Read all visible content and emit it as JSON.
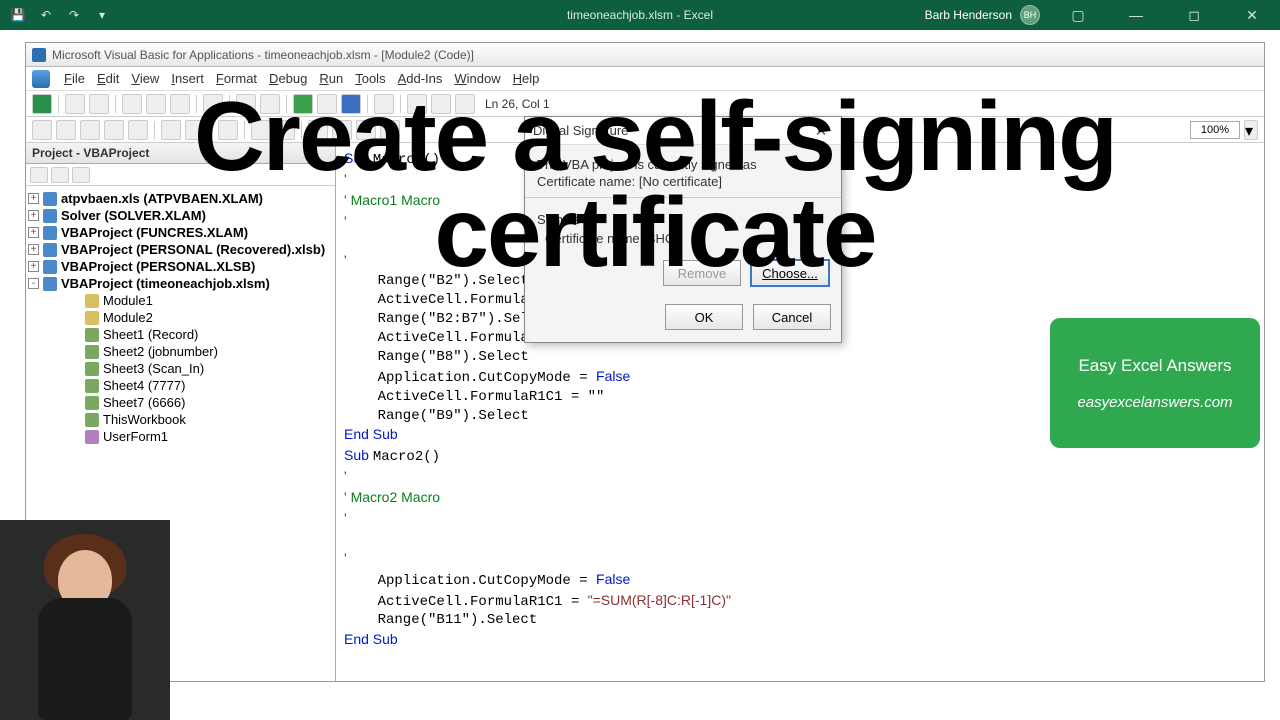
{
  "excel": {
    "doc_title": "timeoneachjob.xlsm - Excel",
    "user_name": "Barb Henderson",
    "user_initials": "BH"
  },
  "vba": {
    "title": "Microsoft Visual Basic for Applications - timeoneachjob.xlsm - [Module2 (Code)]",
    "menus": [
      "File",
      "Edit",
      "View",
      "Insert",
      "Format",
      "Debug",
      "Run",
      "Tools",
      "Add-Ins",
      "Window",
      "Help"
    ],
    "cursor_pos": "Ln 26, Col 1",
    "zoom": "100%",
    "project_pane_title": "Project - VBAProject",
    "tree": [
      {
        "exp": "+",
        "bold": true,
        "icon": "proj",
        "label": "atpvbaen.xls (ATPVBAEN.XLAM)",
        "indent": 0
      },
      {
        "exp": "+",
        "bold": true,
        "icon": "proj",
        "label": "Solver (SOLVER.XLAM)",
        "indent": 0
      },
      {
        "exp": "+",
        "bold": true,
        "icon": "proj",
        "label": "VBAProject (FUNCRES.XLAM)",
        "indent": 0
      },
      {
        "exp": "+",
        "bold": true,
        "icon": "proj",
        "label": "VBAProject (PERSONAL (Recovered).xlsb)",
        "indent": 0
      },
      {
        "exp": "+",
        "bold": true,
        "icon": "proj",
        "label": "VBAProject (PERSONAL.XLSB)",
        "indent": 0
      },
      {
        "exp": "-",
        "bold": true,
        "icon": "proj",
        "label": "VBAProject (timeoneachjob.xlsm)",
        "indent": 0
      },
      {
        "exp": "",
        "bold": false,
        "icon": "mod",
        "label": "Module1",
        "indent": 2
      },
      {
        "exp": "",
        "bold": false,
        "icon": "mod",
        "label": "Module2",
        "indent": 2
      },
      {
        "exp": "",
        "bold": false,
        "icon": "sht",
        "label": "Sheet1 (Record)",
        "indent": 2
      },
      {
        "exp": "",
        "bold": false,
        "icon": "sht",
        "label": "Sheet2 (jobnumber)",
        "indent": 2
      },
      {
        "exp": "",
        "bold": false,
        "icon": "sht",
        "label": "Sheet3 (Scan_In)",
        "indent": 2
      },
      {
        "exp": "",
        "bold": false,
        "icon": "sht",
        "label": "Sheet4 (7777)",
        "indent": 2
      },
      {
        "exp": "",
        "bold": false,
        "icon": "sht",
        "label": "Sheet7 (6666)",
        "indent": 2
      },
      {
        "exp": "",
        "bold": false,
        "icon": "sht",
        "label": "ThisWorkbook",
        "indent": 2
      },
      {
        "exp": "",
        "bold": false,
        "icon": "form",
        "label": "UserForm1",
        "indent": 2
      }
    ],
    "code": [
      {
        "t": "kw",
        "s": "Sub "
      },
      {
        "t": "",
        "s": "Macro1()"
      },
      {
        "nl": 1
      },
      {
        "t": "cm",
        "s": "'"
      },
      {
        "nl": 1
      },
      {
        "t": "cm",
        "s": "' Macro1 Macro"
      },
      {
        "nl": 1
      },
      {
        "t": "cm",
        "s": "'"
      },
      {
        "nl": 1
      },
      {
        "nl": 1
      },
      {
        "t": "cm",
        "s": "'"
      },
      {
        "nl": 1
      },
      {
        "t": "",
        "s": "    Range(\"B2\").Select"
      },
      {
        "nl": 1
      },
      {
        "t": "",
        "s": "    ActiveCell.FormulaR1C1 = \"\""
      },
      {
        "nl": 1
      },
      {
        "t": "",
        "s": "    Range(\"B2:B7\").Select"
      },
      {
        "nl": 1
      },
      {
        "t": "",
        "s": "    ActiveCell.FormulaR1C1 = \"\""
      },
      {
        "nl": 1
      },
      {
        "t": "",
        "s": "    Range(\"B8\").Select"
      },
      {
        "nl": 1
      },
      {
        "t": "",
        "s": "    Application.CutCopyMode = "
      },
      {
        "t": "kw",
        "s": "False"
      },
      {
        "nl": 1
      },
      {
        "t": "",
        "s": "    ActiveCell.FormulaR1C1 = \"\""
      },
      {
        "nl": 1
      },
      {
        "t": "",
        "s": "    Range(\"B9\").Select"
      },
      {
        "nl": 1
      },
      {
        "t": "kw",
        "s": "End Sub"
      },
      {
        "nl": 1
      },
      {
        "t": "kw",
        "s": "Sub "
      },
      {
        "t": "",
        "s": "Macro2()"
      },
      {
        "nl": 1
      },
      {
        "t": "cm",
        "s": "'"
      },
      {
        "nl": 1
      },
      {
        "t": "cm",
        "s": "' Macro2 Macro"
      },
      {
        "nl": 1
      },
      {
        "t": "cm",
        "s": "'"
      },
      {
        "nl": 1
      },
      {
        "nl": 1
      },
      {
        "t": "cm",
        "s": "'"
      },
      {
        "nl": 1
      },
      {
        "t": "",
        "s": "    Application.CutCopyMode = "
      },
      {
        "t": "kw",
        "s": "False"
      },
      {
        "nl": 1
      },
      {
        "t": "",
        "s": "    ActiveCell.FormulaR1C1 = "
      },
      {
        "t": "str",
        "s": "\"=SUM(R[-8]C:R[-1]C)\""
      },
      {
        "nl": 1
      },
      {
        "t": "",
        "s": "    Range(\"B11\").Select"
      },
      {
        "nl": 1
      },
      {
        "t": "kw",
        "s": "End Sub"
      },
      {
        "nl": 1
      }
    ]
  },
  "dialog": {
    "title": "Digital Signature",
    "body_line1": "The VBA project is currently signed as",
    "body_line2": "Certificate name: [No certificate]",
    "sign_as": "Sign as",
    "cert_label": "Certificate name:  BHC",
    "remove": "Remove",
    "choose": "Choose...",
    "ok": "OK",
    "cancel": "Cancel"
  },
  "overlay": {
    "line1": "Create a self-signing",
    "line2": "certificate"
  },
  "promo": {
    "line1": "Easy Excel Answers",
    "line2": "easyexcelanswers.com"
  }
}
